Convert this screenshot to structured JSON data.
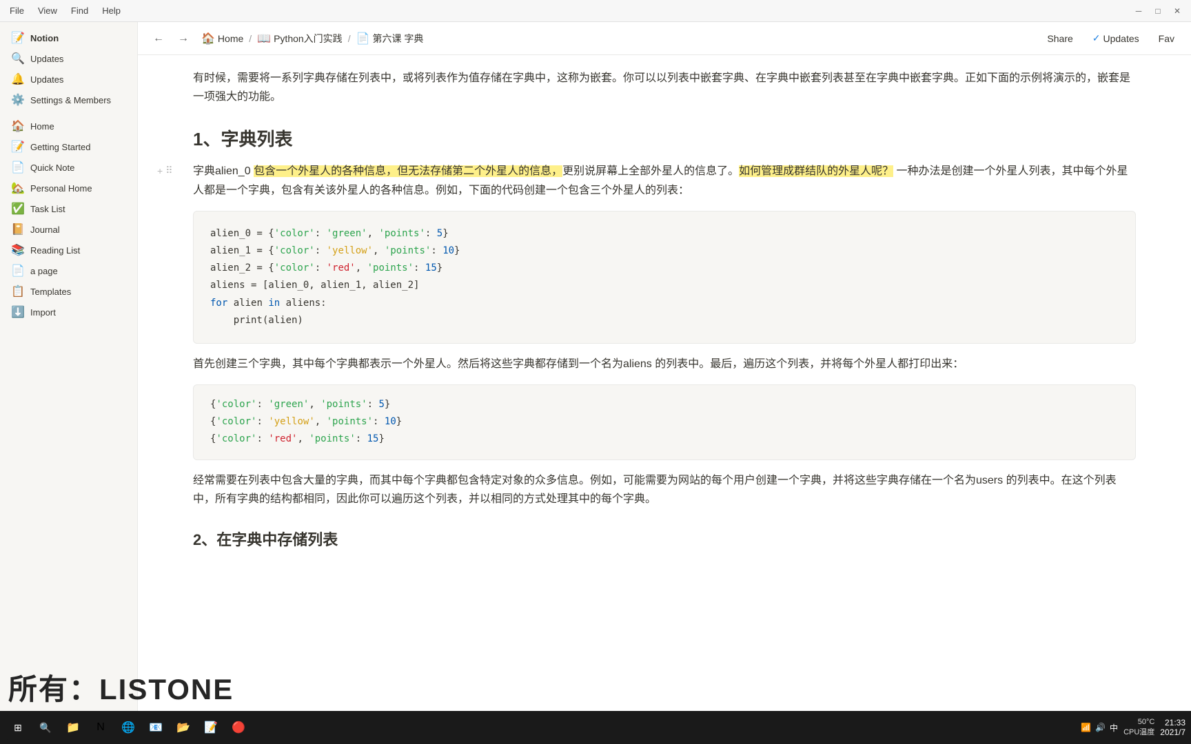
{
  "titleBar": {
    "appName": "Notion",
    "controls": [
      "minimize",
      "maximize",
      "close"
    ]
  },
  "menuBar": {
    "items": [
      "File",
      "View",
      "Find",
      "Help"
    ]
  },
  "sidebar": {
    "items": [
      {
        "id": "home",
        "label": "Home",
        "icon": "🏠"
      },
      {
        "id": "getting-started",
        "label": "Getting Started",
        "icon": "📝"
      },
      {
        "id": "quick-note",
        "label": "Quick Note",
        "icon": "📄"
      },
      {
        "id": "personal-home",
        "label": "Personal Home",
        "icon": "🏡"
      },
      {
        "id": "task-list",
        "label": "Task List",
        "icon": "✅"
      },
      {
        "id": "journal",
        "label": "Journal",
        "icon": "📔"
      },
      {
        "id": "reading-list",
        "label": "Reading List",
        "icon": "📚"
      },
      {
        "id": "a-page",
        "label": "a page",
        "icon": "📄"
      },
      {
        "id": "templates",
        "label": "Templates",
        "icon": "📋"
      },
      {
        "id": "import",
        "label": "Import",
        "icon": "⬇️"
      }
    ],
    "topItems": [
      {
        "id": "notion-updates",
        "label": "Updates",
        "icon": "🔔"
      },
      {
        "id": "settings-members",
        "label": "Settings & Members",
        "icon": "⚙️"
      }
    ]
  },
  "breadcrumb": {
    "items": [
      {
        "label": "Home",
        "icon": "🏠"
      },
      {
        "label": "Python入门实践",
        "icon": "📖"
      },
      {
        "label": "第六课 字典",
        "icon": "📄"
      }
    ],
    "separators": [
      "/",
      "/"
    ]
  },
  "navActions": {
    "share": "Share",
    "updates": "Updates",
    "favorites": "Fav"
  },
  "content": {
    "intro": "有时候，需要将一系列字典存储在列表中，或将列表作为值存储在字典中，这称为嵌套。你可以以列表中嵌套字典、在字典中嵌套列表甚至在字典中嵌套字典。正如下面的示例将演示的，嵌套是一项强大的功能。",
    "section1": {
      "title": "1、字典列表",
      "description1": "字典alien_0 包含一个外星人的各种信息，但无法存储第二个外星人的信息，更别说屏幕上全部外星人的信息了。",
      "highlight": "如何管理成群结队的外星人呢？",
      "description1b": " 一种办法是创建一个外星人列表，其中每个外星人都是一个字典，包含有关该外星人的各种信息。例如，下面的代码创建一个包含三个外星人的列表：",
      "code1": {
        "lines": [
          "alien_0 = {'color': 'green', 'points': 5}",
          "alien_1 = {'color': 'yellow', 'points': 10}",
          "alien_2 = {'color': 'red', 'points': 15}",
          "aliens = [alien_0, alien_1, alien_2]",
          "for alien in aliens:",
          "    print(alien)"
        ]
      },
      "description2": "首先创建三个字典，其中每个字典都表示一个外星人。然后将这些字典都存储到一个名为aliens 的列表中。最后，遍历这个列表，并将每个外星人都打印出来：",
      "output1": {
        "lines": [
          "{'color': 'green', 'points': 5}",
          "{'color': 'yellow', 'points': 10}",
          "{'color': 'red', 'points': 15}"
        ]
      },
      "description3": "经常需要在列表中包含大量的字典，而其中每个字典都包含特定对象的众多信息。例如，可能需要为网站的每个用户创建一个字典，并将这些字典存储在一个名为users 的列表中。在这个列表中，所有字典的结构都相同，因此你可以遍历这个列表，并以相同的方式处理其中的每个字典。"
    },
    "section2": {
      "title": "2、在字典中存储列表"
    }
  },
  "taskbar": {
    "rightItems": {
      "temperature": "50°C",
      "tempLabel": "CPU温度",
      "time": "21:33",
      "date": "2021/7"
    }
  },
  "watermark": {
    "text": "所有：LISTONE"
  }
}
